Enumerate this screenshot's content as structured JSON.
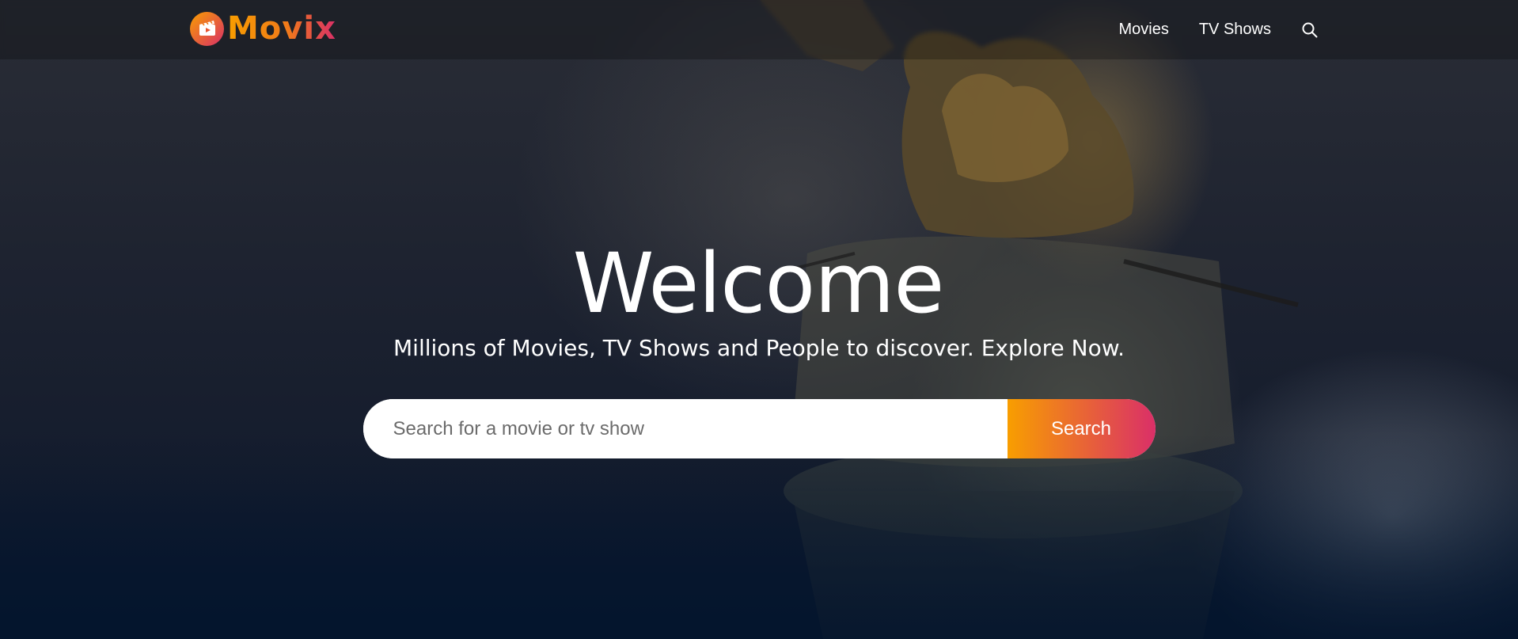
{
  "brand": {
    "name": "Movix"
  },
  "nav": {
    "items": [
      {
        "label": "Movies"
      },
      {
        "label": "TV Shows"
      }
    ],
    "search_icon": "search-icon"
  },
  "hero": {
    "title": "Welcome",
    "subtitle": "Millions of Movies, TV Shows and People to discover. Explore Now.",
    "search": {
      "placeholder": "Search for a movie or tv show",
      "button_label": "Search"
    }
  },
  "colors": {
    "accent_start": "#f89e00",
    "accent_end": "#da2f68",
    "background": "#04152d"
  }
}
